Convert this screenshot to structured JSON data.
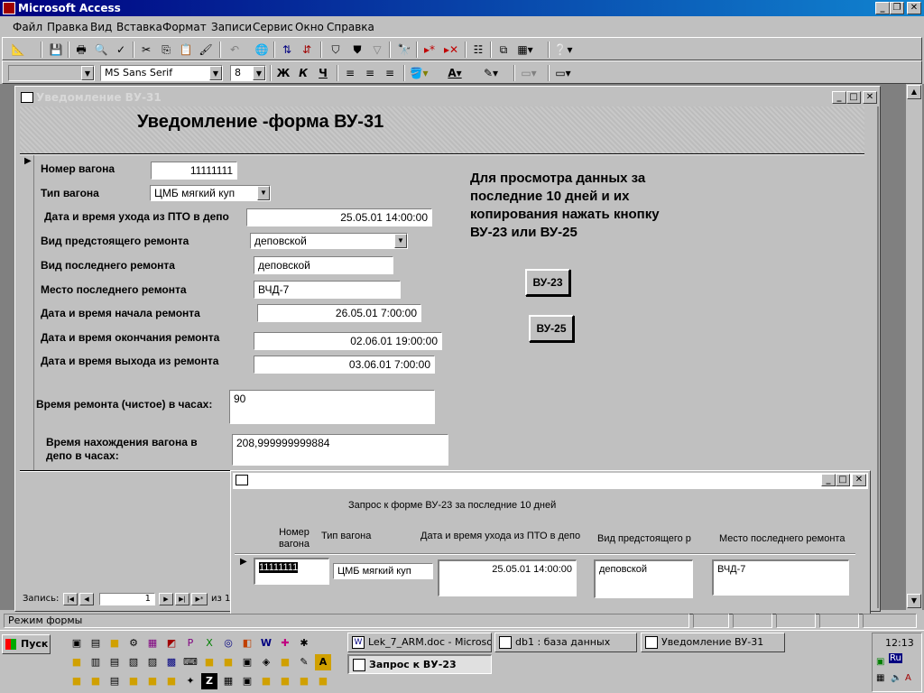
{
  "app": {
    "title": "Microsoft Access"
  },
  "menu": [
    "Файл",
    "Правка",
    "Вид",
    "Вставка",
    "Формат",
    "Записи",
    "Сервис",
    "Окно",
    "Справка"
  ],
  "format_toolbar": {
    "object_combo": "",
    "font": "MS Sans Serif",
    "size": "8",
    "bold": "Ж",
    "italic": "К",
    "underline": "Ч"
  },
  "form": {
    "window_title": "Уведомление ВУ-31",
    "title": "Уведомление -форма ВУ-31",
    "fields": {
      "wagon_number": {
        "label": "Номер вагона",
        "value": "11111111"
      },
      "wagon_type": {
        "label": "Тип вагона",
        "value": "ЦМБ мягкий куп"
      },
      "departure": {
        "label": "Дата и время ухода из ПТО в депо",
        "value": "25.05.01 14:00:00"
      },
      "upcoming_repair": {
        "label": "Вид предстоящего ремонта",
        "value": "деповской"
      },
      "last_repair": {
        "label": "Вид последнего ремонта",
        "value": "деповской"
      },
      "last_repair_place": {
        "label": "Место последнего ремонта",
        "value": "ВЧД-7"
      },
      "repair_start": {
        "label": "Дата и время начала ремонта",
        "value": "26.05.01 7:00:00"
      },
      "repair_end": {
        "label": "Дата и время окончания ремонта",
        "value": "02.06.01 19:00:00"
      },
      "repair_exit": {
        "label": "Дата и время выхода из ремонта",
        "value": "03.06.01 7:00:00"
      },
      "repair_hours": {
        "label": "Время ремонта (чистое) в часах:",
        "value": "90"
      },
      "depot_hours": {
        "label": "Время нахождения вагона в депо в часах:",
        "value": "208,999999999884"
      }
    },
    "hint": "Для просмотра данных за последние 10 дней и их копирования нажать кнопку ВУ-23 или ВУ-25",
    "buttons": {
      "vu23": "ВУ-23",
      "vu25": "ВУ-25"
    },
    "nav": {
      "label": "Запись:",
      "current": "1",
      "of": "из 1"
    }
  },
  "subform": {
    "title": "Запрос к форме ВУ-23 за последние 10 дней",
    "columns": [
      "Номер вагона",
      "Тип вагона",
      "Дата и время ухода из ПТО в депо",
      "Вид предстоящего р",
      "Место последнего ремонта"
    ],
    "row": [
      "11111111",
      "ЦМБ мягкий куп",
      "25.05.01 14:00:00",
      "деповской",
      "ВЧД-7"
    ]
  },
  "status": {
    "mode": "Режим формы"
  },
  "taskbar": {
    "start": "Пуск",
    "tasks": [
      "Lek_7_ARM.doc - Microso...",
      "db1 : база данных",
      "Уведомление ВУ-31",
      "Запрос к ВУ-23"
    ],
    "clock": "12:13",
    "lang": "Ru"
  },
  "colors": {
    "titlebar_active": "#000080",
    "face": "#c0c0c0",
    "workspace": "#808080"
  }
}
